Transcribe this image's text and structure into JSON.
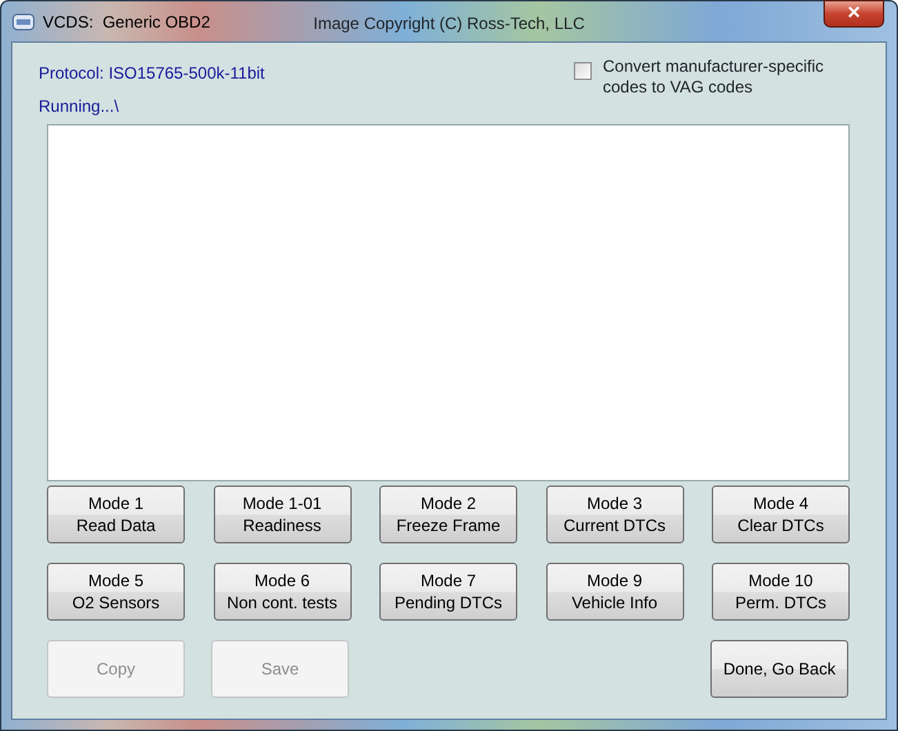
{
  "window": {
    "title": "VCDS:  Generic OBD2",
    "copyright": "Image Copyright (C) Ross-Tech, LLC",
    "close": "×"
  },
  "protocol": "Protocol: ISO15765-500k-11bit",
  "status": "Running...\\",
  "convert_checkbox": {
    "label": "Convert manufacturer-specific codes to VAG codes",
    "checked": false
  },
  "mode_buttons": [
    {
      "lines": [
        "Mode 1",
        "Read Data"
      ],
      "disabled": false
    },
    {
      "lines": [
        "Mode 1-01",
        "Readiness"
      ],
      "disabled": false
    },
    {
      "lines": [
        "Mode 2",
        "Freeze Frame"
      ],
      "disabled": false
    },
    {
      "lines": [
        "Mode 3",
        "Current DTCs"
      ],
      "disabled": false
    },
    {
      "lines": [
        "Mode 4",
        "Clear DTCs"
      ],
      "disabled": false
    },
    {
      "lines": [
        "Mode 5",
        "O2 Sensors"
      ],
      "disabled": false
    },
    {
      "lines": [
        "Mode 6",
        "Non cont. tests"
      ],
      "disabled": false
    },
    {
      "lines": [
        "Mode 7",
        "Pending DTCs"
      ],
      "disabled": false
    },
    {
      "lines": [
        "Mode 9",
        "Vehicle Info"
      ],
      "disabled": false
    },
    {
      "lines": [
        "Mode 10",
        "Perm. DTCs"
      ],
      "disabled": false
    }
  ],
  "left_buttons": [
    {
      "label": "Copy",
      "disabled": true
    },
    {
      "label": "Save",
      "disabled": true
    }
  ],
  "right_buttons": [
    {
      "label": "Done, Go Back",
      "disabled": false
    }
  ]
}
